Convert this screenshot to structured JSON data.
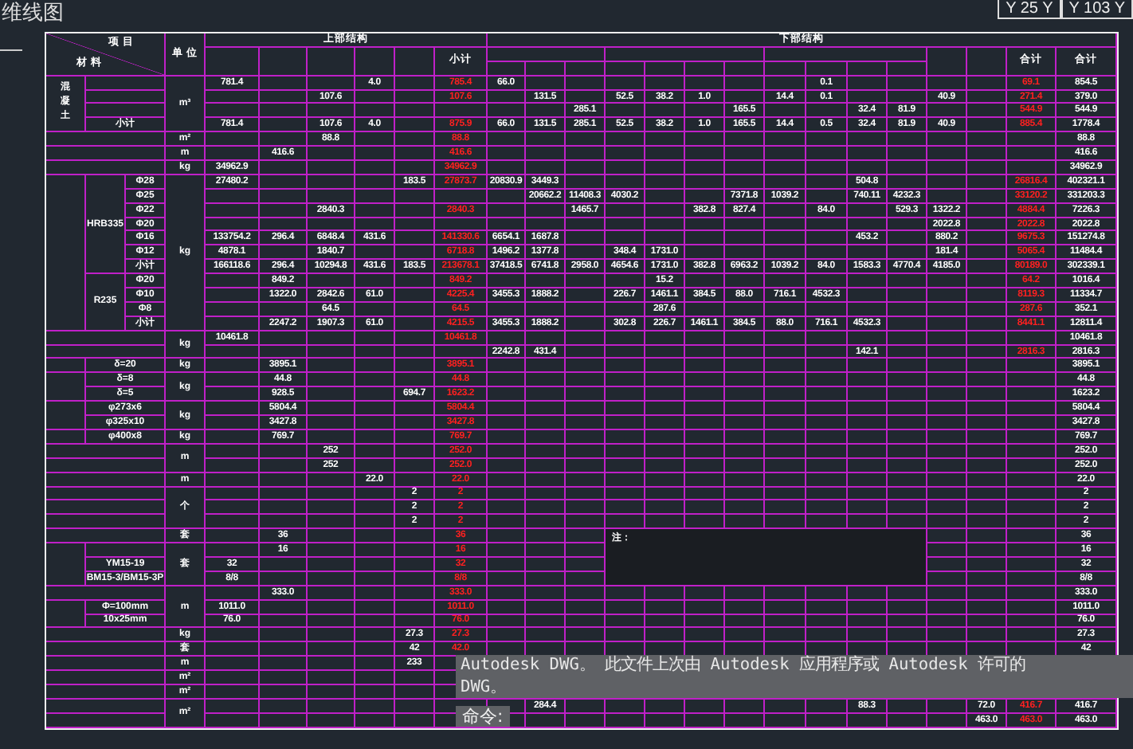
{
  "drawing_title": "维线图",
  "coordinates": [
    "Y 25 Y",
    "Y 103 Y"
  ],
  "table": {
    "corner": {
      "top": "项 目",
      "bottom": "材 料"
    },
    "unit_heading": "单 位",
    "groups": [
      {
        "title": "上部结构"
      },
      {
        "title": "下部结构"
      }
    ],
    "columns": [
      {
        "kind": "plain"
      },
      {
        "kind": "plain"
      },
      {
        "kind": "plain"
      },
      {
        "kind": "plain"
      },
      {
        "kind": "plain"
      },
      {
        "kind": "subtotal",
        "heading": "小计"
      },
      {
        "kind": "plain"
      },
      {
        "kind": "plain"
      },
      {
        "kind": "plain"
      },
      {
        "kind": "plain"
      },
      {
        "kind": "plain"
      },
      {
        "kind": "plain"
      },
      {
        "kind": "plain"
      },
      {
        "kind": "plain"
      },
      {
        "kind": "plain"
      },
      {
        "kind": "plain"
      },
      {
        "kind": "plain"
      },
      {
        "kind": "plain"
      },
      {
        "kind": "plain"
      },
      {
        "kind": "subtotal",
        "heading": "合计"
      },
      {
        "kind": "plain",
        "heading": "合计"
      }
    ],
    "sections": [
      {
        "kind": "grouped",
        "label": "混凝土",
        "rows": [
          {
            "unit": "m³",
            "cells": [
              "781.4",
              null,
              null,
              "4.0",
              null,
              "785.4",
              "66.0",
              null,
              null,
              null,
              null,
              null,
              null,
              null,
              "0.1",
              null,
              null,
              null,
              null,
              "69.1",
              "854.5"
            ]
          },
          {
            "cells": [
              null,
              null,
              "107.6",
              null,
              null,
              "107.6",
              null,
              "131.5",
              null,
              "52.5",
              "38.2",
              "1.0",
              null,
              "14.4",
              "0.1",
              null,
              null,
              "40.9",
              null,
              "271.4",
              "379.0"
            ]
          },
          {
            "cells": [
              null,
              null,
              null,
              null,
              null,
              null,
              null,
              null,
              "285.1",
              null,
              null,
              null,
              "165.5",
              null,
              null,
              "32.4",
              "81.9",
              null,
              null,
              "544.9",
              "544.9"
            ]
          },
          {
            "label": "小计",
            "cells": [
              "781.4",
              null,
              "107.6",
              "4.0",
              null,
              "875.9",
              "66.0",
              "131.5",
              "285.1",
              "52.5",
              "38.2",
              "1.0",
              "165.5",
              "14.4",
              "0.5",
              "32.4",
              "81.9",
              "40.9",
              null,
              "885.4",
              "1778.4"
            ]
          }
        ]
      },
      {
        "kind": "plain",
        "rows": [
          {
            "unit": "m²",
            "cells": [
              null,
              null,
              "88.8",
              null,
              null,
              "88.8",
              null,
              null,
              null,
              null,
              null,
              null,
              null,
              null,
              null,
              null,
              null,
              null,
              null,
              null,
              "88.8"
            ]
          },
          {
            "unit": "m",
            "cells": [
              null,
              "416.6",
              null,
              null,
              null,
              "416.6",
              null,
              null,
              null,
              null,
              null,
              null,
              null,
              null,
              null,
              null,
              null,
              null,
              null,
              null,
              "416.6"
            ]
          },
          {
            "unit": "kg",
            "cells": [
              "34962.9",
              null,
              null,
              null,
              null,
              "34962.9",
              null,
              null,
              null,
              null,
              null,
              null,
              null,
              null,
              null,
              null,
              null,
              null,
              null,
              null,
              "34962.9"
            ]
          }
        ]
      },
      {
        "kind": "grouped",
        "rows": [
          {
            "sub": "HRB335",
            "label": "Φ28",
            "unit": "kg",
            "cells": [
              "27480.2",
              null,
              null,
              null,
              "183.5",
              "27873.7",
              "20830.9",
              "3449.3",
              null,
              null,
              null,
              null,
              null,
              null,
              null,
              "504.8",
              null,
              null,
              null,
              "26816.4",
              "402321.1"
            ]
          },
          {
            "label": "Φ25",
            "cells": [
              null,
              null,
              null,
              null,
              null,
              null,
              null,
              "20662.2",
              "11408.3",
              "4030.2",
              null,
              null,
              "7371.8",
              "1039.2",
              null,
              "740.11",
              "4232.3",
              null,
              null,
              "33120.2",
              "331203.3"
            ]
          },
          {
            "label": "Φ22",
            "cells": [
              null,
              null,
              "2840.3",
              null,
              null,
              "2840.3",
              null,
              null,
              "1465.7",
              null,
              null,
              "382.8",
              "827.4",
              null,
              "84.0",
              null,
              "529.3",
              "1322.2",
              null,
              "4884.4",
              "7226.3"
            ]
          },
          {
            "label": "Φ20",
            "cells": [
              null,
              null,
              null,
              null,
              null,
              null,
              null,
              null,
              null,
              null,
              null,
              null,
              null,
              null,
              null,
              null,
              null,
              "2022.8",
              null,
              "2022.8",
              "2022.8"
            ]
          },
          {
            "label": "Φ16",
            "cells": [
              "133754.2",
              "296.4",
              "6848.4",
              "431.6",
              null,
              "141330.6",
              "6654.1",
              "1687.8",
              null,
              null,
              null,
              null,
              null,
              null,
              null,
              "453.2",
              null,
              "880.2",
              null,
              "9675.3",
              "151274.8"
            ]
          },
          {
            "label": "Φ12",
            "cells": [
              "4878.1",
              null,
              "1840.7",
              null,
              null,
              "6718.8",
              "1496.2",
              "1377.8",
              null,
              "348.4",
              "1731.0",
              null,
              null,
              null,
              null,
              null,
              null,
              "181.4",
              null,
              "5065.4",
              "11484.4"
            ]
          },
          {
            "label": "小计",
            "cells": [
              "166118.6",
              "296.4",
              "10294.8",
              "431.6",
              "183.5",
              "213678.1",
              "37418.5",
              "6741.8",
              "2958.0",
              "4654.6",
              "1731.0",
              "382.8",
              "6963.2",
              "1039.2",
              "84.0",
              "1583.3",
              "4770.4",
              "4185.0",
              null,
              "80189.0",
              "302339.1"
            ]
          },
          {
            "sub": "R235",
            "label": "Φ20",
            "cells": [
              null,
              "849.2",
              null,
              null,
              null,
              "849.2",
              null,
              null,
              null,
              null,
              "15.2",
              null,
              null,
              null,
              null,
              null,
              null,
              null,
              null,
              "64.2",
              "1016.4"
            ]
          },
          {
            "label": "Φ10",
            "cells": [
              null,
              "1322.0",
              "2842.6",
              "61.0",
              null,
              "4225.4",
              "3455.3",
              "1888.2",
              null,
              "226.7",
              "1461.1",
              "384.5",
              "88.0",
              "716.1",
              "4532.3",
              null,
              null,
              null,
              null,
              "8119.3",
              "11334.7"
            ]
          },
          {
            "label": "Φ8",
            "cells": [
              null,
              null,
              "64.5",
              null,
              null,
              "64.5",
              null,
              null,
              null,
              null,
              "287.6",
              null,
              null,
              null,
              null,
              null,
              null,
              null,
              null,
              "287.6",
              "352.1"
            ]
          },
          {
            "label": "小计",
            "cells": [
              null,
              "2247.2",
              "1907.3",
              "61.0",
              null,
              "4215.5",
              "3455.3",
              "1888.2",
              null,
              "302.8",
              "226.7",
              "1461.1",
              "384.5",
              "88.0",
              "716.1",
              "4532.3",
              null,
              null,
              null,
              "8441.1",
              "12811.4"
            ]
          }
        ]
      },
      {
        "kind": "plain",
        "rows": [
          {
            "unit": "kg",
            "cells": [
              "10461.8",
              null,
              null,
              null,
              null,
              "10461.8",
              null,
              null,
              null,
              null,
              null,
              null,
              null,
              null,
              null,
              null,
              null,
              null,
              null,
              null,
              "10461.8"
            ]
          },
          {
            "cells": [
              null,
              null,
              null,
              null,
              null,
              null,
              "2242.8",
              "431.4",
              null,
              null,
              null,
              null,
              null,
              null,
              null,
              "142.1",
              null,
              null,
              null,
              "2816.3",
              "2816.3"
            ]
          }
        ]
      },
      {
        "kind": "grouped",
        "rows": [
          {
            "label": "δ=20",
            "unit": "kg",
            "cells": [
              null,
              "3895.1",
              null,
              null,
              null,
              "3895.1",
              null,
              null,
              null,
              null,
              null,
              null,
              null,
              null,
              null,
              null,
              null,
              null,
              null,
              null,
              "3895.1"
            ]
          }
        ]
      },
      {
        "kind": "grouped",
        "rows": [
          {
            "label": "δ=8",
            "unit": "kg",
            "cells": [
              null,
              "44.8",
              null,
              null,
              null,
              "44.8",
              null,
              null,
              null,
              null,
              null,
              null,
              null,
              null,
              null,
              null,
              null,
              null,
              null,
              null,
              "44.8"
            ]
          },
          {
            "label": "δ=5",
            "cells": [
              null,
              "928.5",
              null,
              null,
              "694.7",
              "1623.2",
              null,
              null,
              null,
              null,
              null,
              null,
              null,
              null,
              null,
              null,
              null,
              null,
              null,
              null,
              "1623.2"
            ]
          }
        ]
      },
      {
        "kind": "grouped",
        "rows": [
          {
            "label": "φ273x6",
            "unit": "kg",
            "cells": [
              null,
              "5804.4",
              null,
              null,
              null,
              "5804.4",
              null,
              null,
              null,
              null,
              null,
              null,
              null,
              null,
              null,
              null,
              null,
              null,
              null,
              null,
              "5804.4"
            ]
          },
          {
            "label": "φ325x10",
            "cells": [
              null,
              "3427.8",
              null,
              null,
              null,
              "3427.8",
              null,
              null,
              null,
              null,
              null,
              null,
              null,
              null,
              null,
              null,
              null,
              null,
              null,
              null,
              "3427.8"
            ]
          }
        ]
      },
      {
        "kind": "grouped",
        "rows": [
          {
            "label": "φ400x8",
            "unit": "kg",
            "cells": [
              null,
              "769.7",
              null,
              null,
              null,
              "769.7",
              null,
              null,
              null,
              null,
              null,
              null,
              null,
              null,
              null,
              null,
              null,
              null,
              null,
              null,
              "769.7"
            ]
          }
        ]
      },
      {
        "kind": "plain",
        "rows": [
          {
            "unit": "m",
            "cells": [
              null,
              null,
              "252",
              null,
              null,
              "252.0",
              null,
              null,
              null,
              null,
              null,
              null,
              null,
              null,
              null,
              null,
              null,
              null,
              null,
              null,
              "252.0"
            ]
          },
          {
            "cells": [
              null,
              null,
              "252",
              null,
              null,
              "252.0",
              null,
              null,
              null,
              null,
              null,
              null,
              null,
              null,
              null,
              null,
              null,
              null,
              null,
              null,
              "252.0"
            ]
          },
          {
            "unit": "m",
            "cells": [
              null,
              null,
              null,
              "22.0",
              null,
              "22.0",
              null,
              null,
              null,
              null,
              null,
              null,
              null,
              null,
              null,
              null,
              null,
              null,
              null,
              null,
              "22.0"
            ]
          },
          {
            "unit": "个",
            "cells": [
              null,
              null,
              null,
              null,
              "2",
              "2",
              null,
              null,
              null,
              null,
              null,
              null,
              null,
              null,
              null,
              null,
              null,
              null,
              null,
              null,
              "2"
            ]
          },
          {
            "cells": [
              null,
              null,
              null,
              null,
              "2",
              "2",
              null,
              null,
              null,
              null,
              null,
              null,
              null,
              null,
              null,
              null,
              null,
              null,
              null,
              null,
              "2"
            ]
          },
          {
            "cells": [
              null,
              null,
              null,
              null,
              "2",
              "2",
              null,
              null,
              null,
              null,
              null,
              null,
              null,
              null,
              null,
              null,
              null,
              null,
              null,
              null,
              "2"
            ]
          },
          {
            "unit": "套",
            "cells": [
              null,
              "36",
              null,
              null,
              null,
              "36",
              null,
              null,
              null,
              null,
              null,
              null,
              null,
              null,
              null,
              null,
              null,
              null,
              null,
              null,
              "36"
            ]
          }
        ]
      },
      {
        "kind": "grouped",
        "rows": [
          {
            "unit": "套",
            "cells": [
              null,
              "16",
              null,
              null,
              null,
              "16",
              null,
              null,
              null,
              null,
              null,
              null,
              null,
              null,
              null,
              null,
              null,
              null,
              null,
              null,
              "16"
            ]
          },
          {
            "label": "YM15-19",
            "cells": [
              "32",
              null,
              null,
              null,
              null,
              "32",
              null,
              null,
              null,
              null,
              null,
              null,
              null,
              null,
              null,
              null,
              null,
              null,
              null,
              null,
              "32"
            ]
          },
          {
            "label": "BM15-3/BM15-3P",
            "cells": [
              "8/8",
              null,
              null,
              null,
              null,
              "8/8",
              null,
              null,
              null,
              null,
              null,
              null,
              null,
              null,
              null,
              null,
              null,
              null,
              null,
              null,
              "8/8"
            ]
          }
        ]
      },
      {
        "kind": "plain",
        "rows": [
          {
            "unit": "m",
            "cells": [
              null,
              "333.0",
              null,
              null,
              null,
              "333.0",
              null,
              null,
              null,
              null,
              null,
              null,
              null,
              null,
              null,
              null,
              null,
              null,
              null,
              null,
              "333.0"
            ]
          }
        ]
      },
      {
        "kind": "grouped",
        "rows": [
          {
            "label": "Φ=100mm",
            "cells": [
              "1011.0",
              null,
              null,
              null,
              null,
              "1011.0",
              null,
              null,
              null,
              null,
              null,
              null,
              null,
              null,
              null,
              null,
              null,
              null,
              null,
              null,
              "1011.0"
            ]
          },
          {
            "label": "10x25mm",
            "cells": [
              "76.0",
              null,
              null,
              null,
              null,
              "76.0",
              null,
              null,
              null,
              null,
              null,
              null,
              null,
              null,
              null,
              null,
              null,
              null,
              null,
              null,
              "76.0"
            ]
          }
        ]
      },
      {
        "kind": "plain",
        "rows": [
          {
            "unit": "kg",
            "cells": [
              null,
              null,
              null,
              null,
              "27.3",
              "27.3",
              null,
              null,
              null,
              null,
              null,
              null,
              null,
              null,
              null,
              null,
              null,
              null,
              null,
              null,
              "27.3"
            ]
          },
          {
            "unit": "套",
            "cells": [
              null,
              null,
              null,
              null,
              "42",
              "42.0",
              null,
              null,
              null,
              null,
              null,
              null,
              null,
              null,
              null,
              null,
              null,
              null,
              null,
              null,
              "42"
            ]
          },
          {
            "unit": "m",
            "cells": [
              null,
              null,
              null,
              null,
              "233",
              null,
              null,
              null,
              null,
              null,
              null,
              null,
              null,
              null,
              null,
              null,
              null,
              null,
              null,
              null,
              null
            ]
          },
          {
            "unit": "m²",
            "cells": [
              null,
              null,
              null,
              null,
              null,
              null,
              null,
              null,
              null,
              null,
              null,
              null,
              null,
              null,
              null,
              null,
              null,
              null,
              null,
              null,
              null
            ]
          },
          {
            "unit": "m²",
            "cells": [
              null,
              null,
              null,
              null,
              null,
              null,
              null,
              null,
              null,
              null,
              null,
              null,
              null,
              null,
              null,
              null,
              null,
              null,
              null,
              null,
              null
            ]
          },
          {
            "unit": "m²",
            "cells": [
              null,
              null,
              null,
              null,
              null,
              null,
              null,
              "284.4",
              null,
              null,
              null,
              null,
              null,
              null,
              null,
              "88.3",
              null,
              null,
              "72.0",
              "416.7",
              "416.7"
            ]
          },
          {
            "cells": [
              null,
              null,
              null,
              null,
              null,
              null,
              null,
              null,
              null,
              null,
              null,
              null,
              null,
              null,
              null,
              null,
              null,
              null,
              "463.0",
              "463.0",
              "463.0"
            ]
          }
        ]
      }
    ],
    "notes": {
      "heading": "注："
    }
  },
  "command_line": {
    "lines": [
      "Autodesk DWG。  此文件上次由 Autodesk 应用程序或 Autodesk 许可的",
      "DWG。"
    ],
    "prompts": [
      "命令:"
    ]
  }
}
